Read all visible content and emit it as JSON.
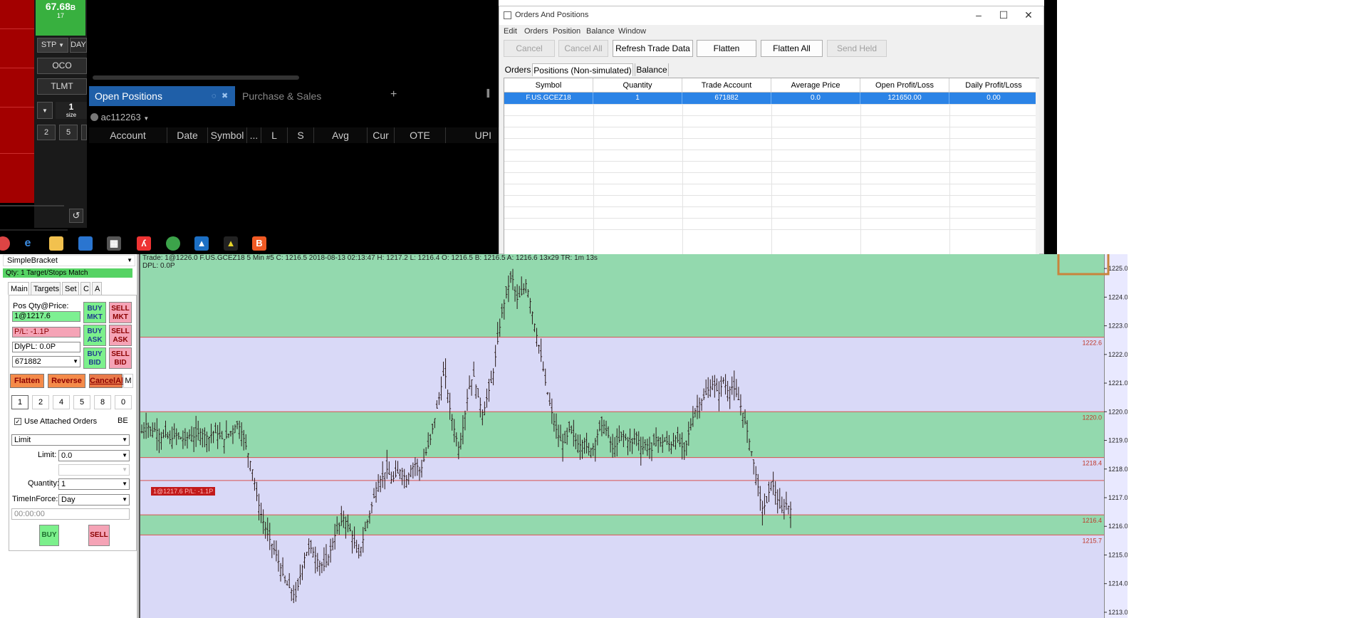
{
  "platform": {
    "bid": {
      "price": "67.68",
      "price_suffix": "B",
      "size": "17"
    },
    "order_type_label": "STP",
    "tif_label": "DAY",
    "oco_label": "OCO",
    "tlmt_label": "TLMT",
    "size": {
      "value": "1",
      "label": "size"
    },
    "quick_sizes": [
      "2",
      "5"
    ],
    "tabs": {
      "open_positions": "Open Positions",
      "purchase_sales": "Purchase & Sales",
      "add": "+"
    },
    "account": "ac112263",
    "columns": [
      "Account",
      "Date",
      "Symbol",
      "...",
      "L",
      "S",
      "Avg",
      "Cur",
      "OTE",
      "UPI"
    ]
  },
  "taskbar_icons": [
    "chrome-icon",
    "edge-icon",
    "explorer-icon",
    "store-icon",
    "calculator-icon",
    "acrobat-icon",
    "globe-icon",
    "app-icon",
    "mt-icon",
    "brave-icon"
  ],
  "orders_window": {
    "title": "Orders And Positions",
    "menu": [
      "Edit",
      "Orders",
      "Position",
      "Balance",
      "Window"
    ],
    "buttons": {
      "cancel": "Cancel",
      "cancel_all": "Cancel All",
      "refresh": "Refresh Trade Data",
      "flatten": "Flatten",
      "flatten_all": "Flatten All",
      "send_held": "Send Held"
    },
    "tabs": [
      "Orders",
      "Positions (Non-simulated)",
      "Balance"
    ],
    "columns": [
      "Symbol",
      "Quantity",
      "Trade Account",
      "Average Price",
      "Open Profit/Loss",
      "Daily Profit/Loss"
    ],
    "rows": [
      [
        "F.US.GCEZ18",
        "1",
        "671882",
        "0.0",
        "121650.00",
        "0.00"
      ]
    ]
  },
  "bracket": {
    "title": "SimpleBracket",
    "qty_banner": "Qty: 1 Target/Stops Match",
    "tabs": [
      "Main",
      "Targets",
      "Set",
      "C",
      "A"
    ],
    "pos_label": "Pos Qty@Price:",
    "pos_value": "1@1217.6",
    "pl_value": "P/L: -1.1P",
    "dlypl_value": "DlyPL: 0.0P",
    "account": "671882",
    "buy_mkt": [
      "BUY",
      "MKT"
    ],
    "sell_mkt": [
      "SELL",
      "MKT"
    ],
    "buy_ask": [
      "BUY",
      "ASK"
    ],
    "sell_ask": [
      "SELL",
      "ASK"
    ],
    "buy_bid": [
      "BUY",
      "BID"
    ],
    "sell_bid": [
      "SELL",
      "BID"
    ],
    "flatten": "Flatten",
    "reverse": "Reverse",
    "cancel_all": "CancelAll",
    "m": "M",
    "qty_buttons": [
      "1",
      "2",
      "4",
      "5",
      "8",
      "0"
    ],
    "use_attached_label": "Use Attached Orders",
    "use_attached_checked": true,
    "be_label": "BE",
    "order_type": "Limit",
    "limit_label": "Limit:",
    "limit_value": "0.0",
    "quantity_label": "Quantity:",
    "quantity_value": "1",
    "tif_label": "TimeInForce:",
    "tif_value": "Day",
    "time_value": "00:00:00",
    "buy": "BUY",
    "sell": "SELL"
  },
  "chart_info": {
    "header_text": "Trade: 1@1226.0  F.US.GCEZ18  5 Min  #5 C: 1216.5 2018-08-13 02:13:47 H: 1217.2 L: 1216.4 O: 1216.5 B: 1216.5 A: 1216.6 13x29 TR: 1m 13s",
    "dpl": "DPL: 0.0P",
    "position_tag": "1@1217.6 P/L: -1.1P"
  },
  "chart_data": {
    "type": "ohlc",
    "symbol": "F.US.GCEZ18",
    "interval": "5 Min",
    "ylim": [
      1212.8,
      1225.5
    ],
    "y_ticks": [
      "1225.0",
      "1224.0",
      "1223.0",
      "1222.0",
      "1221.0",
      "1220.0",
      "1219.0",
      "1218.0",
      "1217.0",
      "1216.0",
      "1215.0",
      "1214.0",
      "1213.0"
    ],
    "zones": [
      {
        "from": 1222.6,
        "to": 1225.5,
        "color": "#93d9ae"
      },
      {
        "from": 1222.6,
        "to": 1220.0,
        "color": "#d9d9f7"
      },
      {
        "from": 1220.0,
        "to": 1218.4,
        "color": "#93d9ae"
      },
      {
        "from": 1218.4,
        "to": 1216.4,
        "color": "#d9d9f7"
      },
      {
        "from": 1216.4,
        "to": 1215.7,
        "color": "#93d9ae"
      },
      {
        "from": 1215.7,
        "to": 1212.8,
        "color": "#d9d9f7"
      }
    ],
    "levels": [
      {
        "value": 1222.6,
        "label": "1222.6"
      },
      {
        "value": 1220.0,
        "label": "1220.0"
      },
      {
        "value": 1218.4,
        "label": "1218.4"
      },
      {
        "value": 1217.6,
        "label": ""
      },
      {
        "value": 1216.4,
        "label": "1216.4"
      },
      {
        "value": 1215.7,
        "label": "1215.7"
      }
    ],
    "close_path": [
      1219.3,
      1219.6,
      1219.3,
      1219.4,
      1219.1,
      1219.2,
      1219.0,
      1219.2,
      1219.1,
      1219.0,
      1219.2,
      1219.1,
      1219.3,
      1219.2,
      1219.1,
      1219.3,
      1219.2,
      1219.0,
      1219.2,
      1219.4,
      1219.6,
      1219.2,
      1218.6,
      1218.0,
      1217.0,
      1216.3,
      1215.8,
      1215.4,
      1215.0,
      1214.5,
      1214.0,
      1213.8,
      1213.5,
      1214.3,
      1215.0,
      1215.3,
      1215.0,
      1214.7,
      1214.6,
      1215.0,
      1215.6,
      1216.0,
      1216.3,
      1216.0,
      1215.6,
      1214.9,
      1215.5,
      1216.2,
      1216.8,
      1217.5,
      1217.7,
      1218.0,
      1217.6,
      1217.8,
      1218.0,
      1217.6,
      1218.0,
      1218.2,
      1217.9,
      1218.5,
      1219.0,
      1219.8,
      1220.6,
      1221.5,
      1220.2,
      1219.4,
      1218.7,
      1219.6,
      1220.8,
      1221.3,
      1220.5,
      1219.9,
      1220.6,
      1221.2,
      1222.4,
      1223.5,
      1224.2,
      1224.8,
      1223.9,
      1224.1,
      1224.5,
      1223.7,
      1222.8,
      1222.0,
      1221.0,
      1220.2,
      1219.5,
      1219.0,
      1218.9,
      1219.4,
      1219.1,
      1218.8,
      1219.0,
      1218.6,
      1218.8,
      1219.3,
      1219.6,
      1219.2,
      1218.7,
      1218.9,
      1219.2,
      1219.0,
      1218.9,
      1219.2,
      1218.7,
      1218.9,
      1218.6,
      1219.1,
      1218.9,
      1219.0,
      1218.8,
      1219.1,
      1218.9,
      1218.6,
      1219.4,
      1220.0,
      1220.3,
      1220.5,
      1220.8,
      1221.0,
      1220.6,
      1221.1,
      1220.7,
      1220.9,
      1220.5,
      1220.0,
      1219.3,
      1218.5,
      1217.6,
      1216.6,
      1216.8,
      1217.6,
      1217.1,
      1216.5,
      1216.8,
      1216.6
    ]
  },
  "colors": {
    "accent_blue": "#1f5fa8",
    "selection_blue": "#2b83e6",
    "green_zone": "#93d9ae",
    "lavender_zone": "#d9d9f7",
    "level_red": "#c0392b"
  }
}
